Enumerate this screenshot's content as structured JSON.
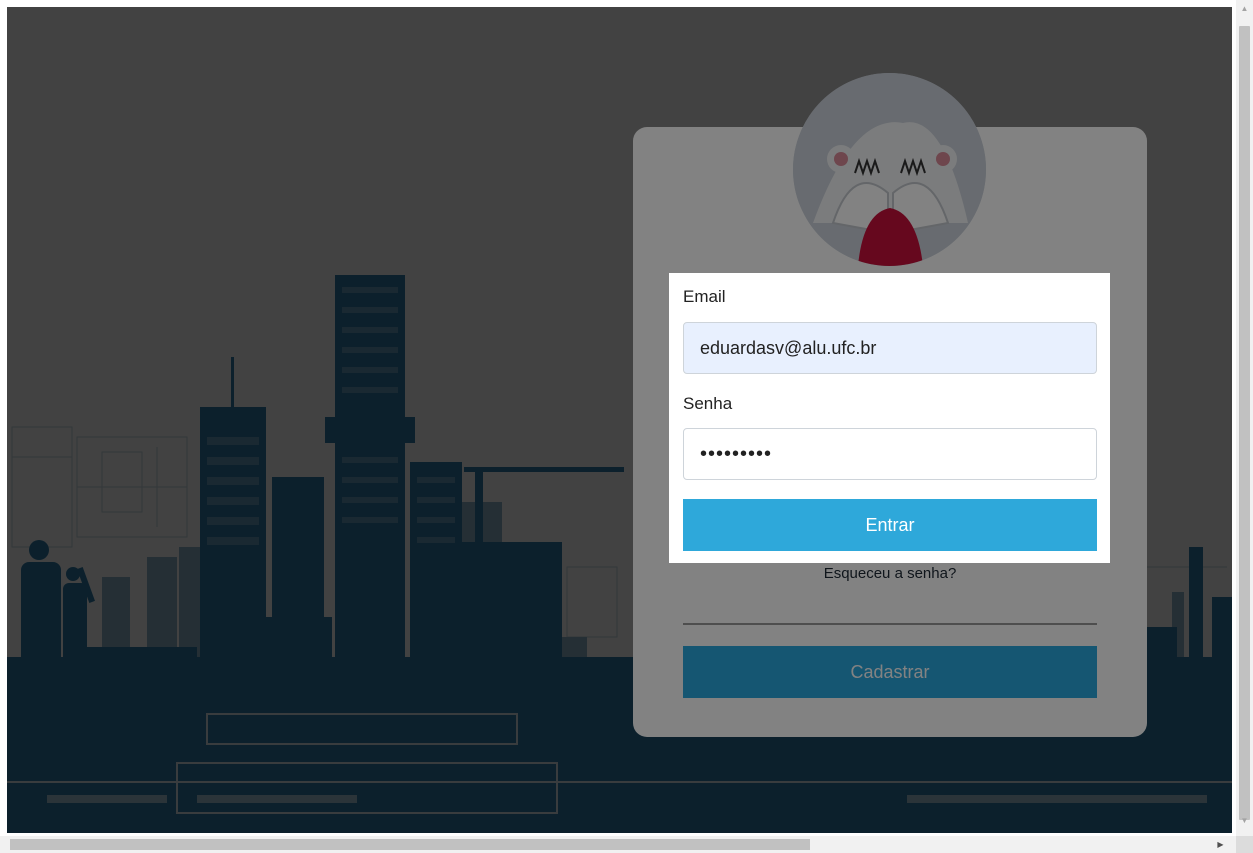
{
  "form": {
    "email_label": "Email",
    "email_value": "eduardasv@alu.ufc.br",
    "password_label": "Senha",
    "password_value": "•••••••••",
    "login_button": "Entrar",
    "forgot_link": "Esqueceu a senha?",
    "register_button": "Cadastrar"
  },
  "colors": {
    "skyline": "#2f7fab",
    "overlay": "rgba(0,0,0,0.49)",
    "button": "#2ea8da",
    "autofill": "#e8f0fe"
  },
  "icons": {
    "avatar": "bear-covering-eyes",
    "scroll_up": "arrow-up-icon",
    "scroll_down": "arrow-down-icon",
    "scroll_right": "arrow-right-icon"
  }
}
